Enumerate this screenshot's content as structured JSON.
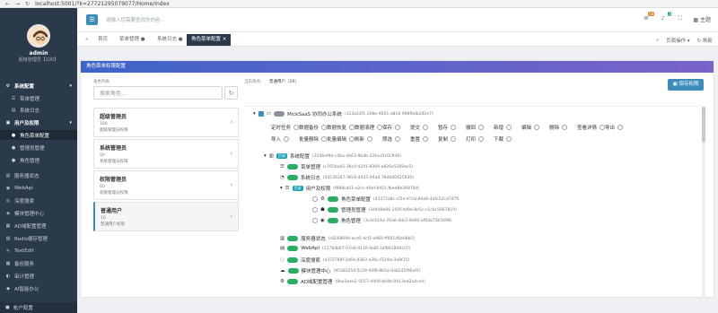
{
  "browser": {
    "url": "localhost:5001/?k=27721295079077/Home/Index"
  },
  "sidebar": {
    "user": {
      "name": "admin",
      "role": "超级管理员【100】"
    },
    "items": [
      {
        "label": "系统配置",
        "icon": "gear-icon",
        "top": true
      },
      {
        "label": "菜单管理",
        "icon": "menu-icon"
      },
      {
        "label": "系统日志",
        "icon": "log-icon"
      },
      {
        "label": "用户及权限",
        "icon": "users-icon",
        "top": true
      },
      {
        "label": "角色菜单配置",
        "icon": "user-cog-icon",
        "sub": true
      },
      {
        "label": "管理员管理",
        "icon": "user-icon",
        "sub": true
      },
      {
        "label": "角色管理",
        "icon": "role-icon",
        "sub": true
      },
      {
        "label": "服务器状态",
        "icon": "server-icon"
      },
      {
        "label": "WebApi",
        "icon": "api-icon"
      },
      {
        "label": "深度搜索",
        "icon": "search-icon"
      },
      {
        "label": "模块管理中心",
        "icon": "module-icon"
      },
      {
        "label": "AD域配置管理",
        "icon": "domain-icon"
      },
      {
        "label": "Redis缓存管理",
        "icon": "redis-icon"
      },
      {
        "label": "TextEdit",
        "icon": "edit-icon"
      },
      {
        "label": "备份服务",
        "icon": "backup-icon"
      },
      {
        "label": "审计管理",
        "icon": "audit-icon"
      },
      {
        "label": "AI智能办公",
        "icon": "ai-icon"
      }
    ],
    "footer": "帐户配置"
  },
  "topbar": {
    "search_placeholder": "请输入您需要查找的内容...",
    "badges": [
      "10",
      "3"
    ],
    "theme_label": "主题"
  },
  "tabs": {
    "items": [
      {
        "label": "首页"
      },
      {
        "label": "菜单管理"
      },
      {
        "label": "系统日志"
      },
      {
        "label": "角色菜单配置",
        "active": true
      }
    ],
    "page_ops": "页面操作",
    "refresh": "刷新"
  },
  "card": {
    "title": "角色菜单权限配置",
    "roles_label": "角色列表",
    "role_search_placeholder": "搜索角色...",
    "roles": [
      {
        "name": "超级管理员",
        "code": "100",
        "desc": "超级管理员权限"
      },
      {
        "name": "系统管理员",
        "code": "50",
        "desc": "系统管理员权限"
      },
      {
        "name": "权限管理员",
        "code": "60",
        "desc": "权限管理员权限"
      },
      {
        "name": "普通用户",
        "code": "10",
        "desc": "普通用户权限",
        "selected": true
      }
    ],
    "current_label": "当前角色:",
    "current_role": "普通用户（10）",
    "save_label": "保存权限",
    "tree": {
      "root": {
        "label": "MickSaaS 协同办公系统",
        "id": "(313a22f1-298e-4601-a816-998f0db282e7)"
      },
      "perms_row1": [
        "定时任务",
        "数据备份",
        "数据恢复",
        "数据清理",
        "保存",
        "提交",
        "暂存",
        "撤回",
        "新增",
        "编辑",
        "删除",
        "查看详情",
        "导出"
      ],
      "perms_row2": [
        "导入",
        "批量删除",
        "批量编辑",
        "刷新",
        "筛选",
        "重置",
        "复制",
        "打印",
        "下载"
      ],
      "system_config": {
        "label": "系统配置",
        "tag": "目录",
        "id": "(3246ef9d-c4ba-4b63-9b4b-331ed1c0c930)"
      },
      "menu_mgmt": {
        "label": "菜单管理",
        "id": "(c765beb5-36c0-42d1-8309-a826e5269ac5)"
      },
      "sys_log": {
        "label": "系统日志",
        "id": "(0d530347-36c6-4425-94a0-78d440425930)"
      },
      "user_perm": {
        "label": "用户及权限",
        "tag": "目录",
        "id": "(f888ca61-e2cc-49ef-8451-fbed8b26878d)"
      },
      "role_menu": {
        "label": "角色菜单配置",
        "id": "(41272a8c-cf2e-47cb-84a6-4afe52cd747f)"
      },
      "admin_mgmt": {
        "label": "管理员管理",
        "id": "(344d9d06-205f-4d9d-8e5c-c1c6c5667819)"
      },
      "role_mgmt": {
        "label": "角色管理",
        "id": "(3cdc614a-76a8-4dc2-9e66-af6da75b5098)"
      },
      "server_status": {
        "label": "服务器状态",
        "id": "(c8268694-ecd5-4cf1-a960-ff001d6b08b5)"
      },
      "webapi": {
        "label": "WebApi",
        "id": "(2176db67-07e6-4116-9a8f-3af8918092d7)"
      },
      "deep_search": {
        "label": "深度搜索",
        "id": "(a372768f-3d64-4363-a26c-f314ec3e9f15)"
      },
      "module_center": {
        "label": "模块管理中心",
        "id": "(95383254-5c29-40f8-8b5a-0a8245f96af4)"
      },
      "ad_config": {
        "label": "AD域配置管理",
        "id": "(8ae3aee2-5017-4d09-b04b-9413ed2a4ce4)"
      }
    }
  },
  "colors": {
    "sidebar": "#2b3a4a",
    "accent": "#3c8dbc",
    "header_gradient_start": "#3e64c9",
    "header_gradient_end": "#7a63c9",
    "success": "#27ae60"
  }
}
